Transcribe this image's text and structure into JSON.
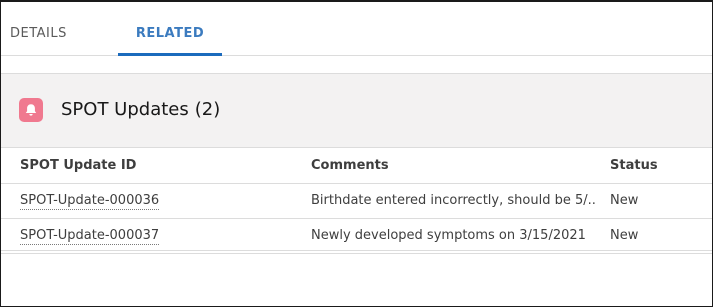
{
  "tabs": [
    {
      "label": "DETAILS",
      "active": false
    },
    {
      "label": "RELATED",
      "active": true
    }
  ],
  "related_list": {
    "title": "SPOT Updates",
    "count": "(2)",
    "icon": "bell-icon",
    "icon_color": "#f0798f",
    "columns": [
      "SPOT Update ID",
      "Comments",
      "Status"
    ],
    "rows": [
      {
        "id": "SPOT-Update-000036",
        "comments": "Birthdate entered incorrectly, should be 5/...",
        "status": "New"
      },
      {
        "id": "SPOT-Update-000037",
        "comments": "Newly developed symptoms on 3/15/2021",
        "status": "New"
      }
    ]
  },
  "colors": {
    "active_tab": "#1b6bbd",
    "header_bg": "#f3f2f2",
    "border": "#dcdcdc"
  }
}
